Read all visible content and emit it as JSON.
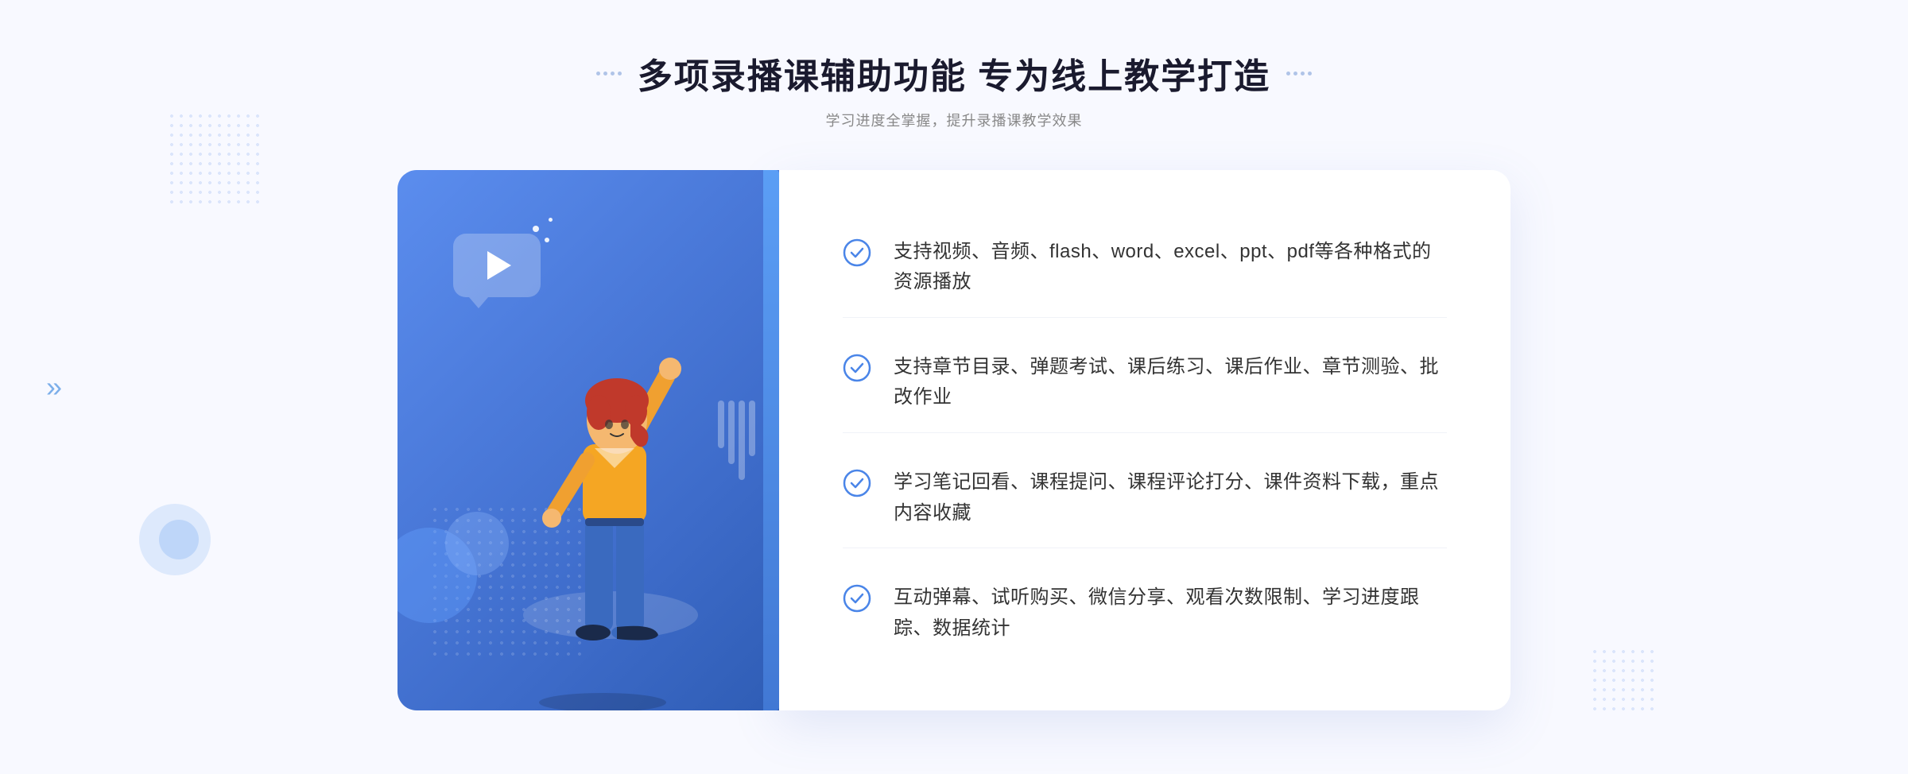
{
  "page": {
    "background": "#f8f9ff"
  },
  "header": {
    "title": "多项录播课辅助功能 专为线上教学打造",
    "subtitle": "学习进度全掌握，提升录播课教学效果",
    "decorator_left": "···",
    "decorator_right": "···"
  },
  "features": [
    {
      "id": 1,
      "text": "支持视频、音频、flash、word、excel、ppt、pdf等各种格式的资源播放"
    },
    {
      "id": 2,
      "text": "支持章节目录、弹题考试、课后练习、课后作业、章节测验、批改作业"
    },
    {
      "id": 3,
      "text": "学习笔记回看、课程提问、课程评论打分、课件资料下载，重点内容收藏"
    },
    {
      "id": 4,
      "text": "互动弹幕、试听购买、微信分享、观看次数限制、学习进度跟踪、数据统计"
    }
  ],
  "illustration": {
    "play_button": "▶",
    "chevron": "»"
  }
}
